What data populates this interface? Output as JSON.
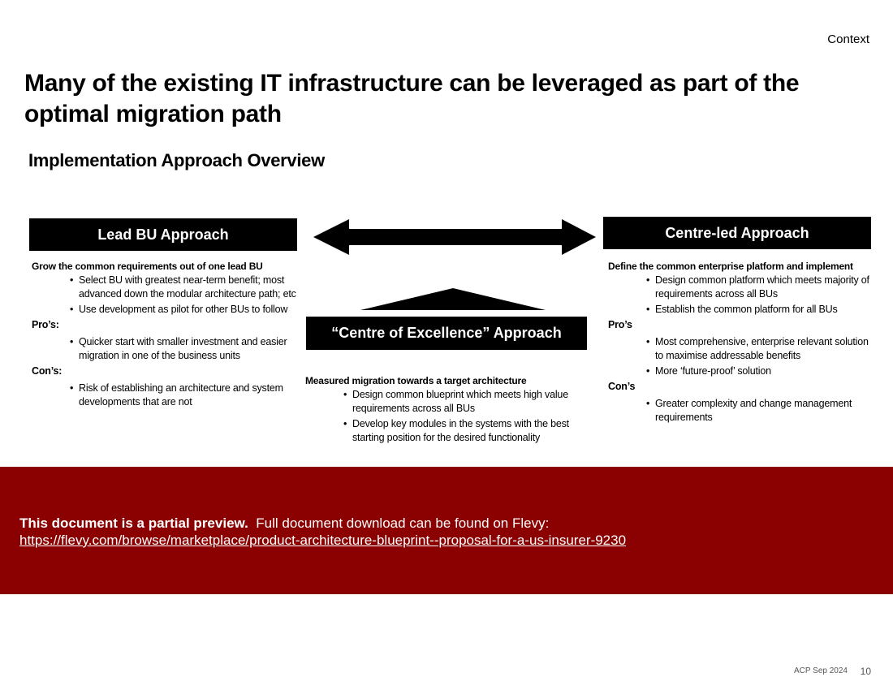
{
  "header": {
    "section": "Context",
    "title": "Many of the existing IT infrastructure can be leveraged as part of the optimal migration path",
    "subtitle": "Implementation Approach Overview"
  },
  "columns": {
    "left": {
      "heading": "Lead BU Approach",
      "lead": "Grow the common requirements out of one lead BU",
      "bullets": [
        "Select BU with greatest near-term benefit; most advanced down the modular architecture path; etc",
        "Use development as pilot for other BUs to follow"
      ],
      "pros_label": "Pro’s:",
      "pros": [
        "Quicker start with smaller investment and easier migration in one of the business units"
      ],
      "cons_label": "Con’s:",
      "cons": [
        "Risk of establishing an architecture and system developments that are not"
      ]
    },
    "center": {
      "heading": "“Centre of Excellence” Approach",
      "lead": "Measured migration towards a target architecture",
      "bullets": [
        "Design common blueprint which meets high value requirements across all BUs",
        "Develop key modules in the systems with the best starting position for the desired functionality"
      ]
    },
    "right": {
      "heading": "Centre-led Approach",
      "lead": "Define the common enterprise platform and implement",
      "bullets": [
        "Design common platform which meets majority of requirements across all BUs",
        "Establish the common platform for all BUs"
      ],
      "pros_label": "Pro’s",
      "pros": [
        "Most comprehensive, enterprise relevant solution to maximise addressable benefits",
        "More ‘future-proof’ solution"
      ],
      "cons_label": "Con’s",
      "cons": [
        "Greater complexity and change management requirements"
      ]
    }
  },
  "banner": {
    "bold": "This document is a partial preview.",
    "text": "Full document download can be found on Flevy:",
    "link": "https://flevy.com/browse/marketplace/product-architecture-blueprint--proposal-for-a-us-insurer-9230",
    "color": "#8b0000"
  },
  "footer": {
    "label": "ACP Sep 2024",
    "page": "10"
  }
}
